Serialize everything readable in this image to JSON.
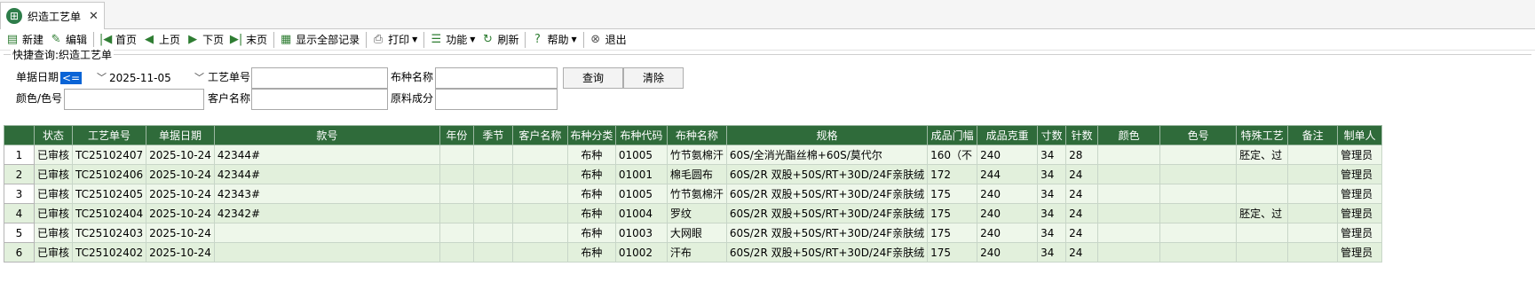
{
  "tab": {
    "title": "织造工艺单",
    "close": "✕",
    "icon": "grid-icon"
  },
  "toolbar": {
    "new": "新建",
    "edit": "编辑",
    "first": "首页",
    "prev": "上页",
    "next": "下页",
    "last": "末页",
    "show_all": "显示全部记录",
    "print": "打印",
    "function": "功能",
    "refresh": "刷新",
    "help": "帮助",
    "exit": "退出"
  },
  "query": {
    "legend": "快捷查询:织造工艺单",
    "date_label": "单据日期",
    "date_op": "<=",
    "date_value": "2025-11-05",
    "craft_no_label": "工艺单号",
    "fabric_name_label": "布种名称",
    "color_label": "颜色/色号",
    "customer_label": "客户名称",
    "material_label": "原料成分",
    "search_btn": "查询",
    "clear_btn": "清除"
  },
  "grid": {
    "headers": [
      "状态",
      "工艺单号",
      "单据日期",
      "款号",
      "年份",
      "季节",
      "客户名称",
      "布种分类",
      "布种代码",
      "布种名称",
      "规格",
      "成品门幅",
      "成品克重",
      "寸数",
      "针数",
      "颜色",
      "色号",
      "特殊工艺",
      "备注",
      "制单人"
    ],
    "rows": [
      {
        "n": "1",
        "status": "已审核",
        "no": "TC25102407",
        "date": "2025-10-24",
        "style": "42344#",
        "year": "",
        "season": "",
        "customer": "",
        "cat": "布种",
        "code": "01005",
        "name": "竹节氨棉汗",
        "spec": "60S/全消光酯丝棉+60S/莫代尔",
        "width": "160（不",
        "weight": "240",
        "inch": "34",
        "needle": "28",
        "color": "",
        "color_no": "",
        "special": "胚定、过",
        "remark": "",
        "maker": "管理员"
      },
      {
        "n": "2",
        "status": "已审核",
        "no": "TC25102406",
        "date": "2025-10-24",
        "style": "42344#",
        "year": "",
        "season": "",
        "customer": "",
        "cat": "布种",
        "code": "01001",
        "name": "棉毛圆布",
        "spec": "60S/2R 双股+50S/RT+30D/24F亲肤绒",
        "width": "172",
        "weight": "244",
        "inch": "34",
        "needle": "24",
        "color": "",
        "color_no": "",
        "special": "",
        "remark": "",
        "maker": "管理员"
      },
      {
        "n": "3",
        "status": "已审核",
        "no": "TC25102405",
        "date": "2025-10-24",
        "style": "42343#",
        "year": "",
        "season": "",
        "customer": "",
        "cat": "布种",
        "code": "01005",
        "name": "竹节氨棉汗",
        "spec": "60S/2R 双股+50S/RT+30D/24F亲肤绒",
        "width": "175",
        "weight": "240",
        "inch": "34",
        "needle": "24",
        "color": "",
        "color_no": "",
        "special": "",
        "remark": "",
        "maker": "管理员"
      },
      {
        "n": "4",
        "status": "已审核",
        "no": "TC25102404",
        "date": "2025-10-24",
        "style": "42342#",
        "year": "",
        "season": "",
        "customer": "",
        "cat": "布种",
        "code": "01004",
        "name": "罗纹",
        "spec": "60S/2R 双股+50S/RT+30D/24F亲肤绒",
        "width": "175",
        "weight": "240",
        "inch": "34",
        "needle": "24",
        "color": "",
        "color_no": "",
        "special": "胚定、过",
        "remark": "",
        "maker": "管理员"
      },
      {
        "n": "5",
        "status": "已审核",
        "no": "TC25102403",
        "date": "2025-10-24",
        "style": "",
        "year": "",
        "season": "",
        "customer": "",
        "cat": "布种",
        "code": "01003",
        "name": "大网眼",
        "spec": "60S/2R 双股+50S/RT+30D/24F亲肤绒",
        "width": "175",
        "weight": "240",
        "inch": "34",
        "needle": "24",
        "color": "",
        "color_no": "",
        "special": "",
        "remark": "",
        "maker": "管理员"
      },
      {
        "n": "6",
        "status": "已审核",
        "no": "TC25102402",
        "date": "2025-10-24",
        "style": "",
        "year": "",
        "season": "",
        "customer": "",
        "cat": "布种",
        "code": "01002",
        "name": "汗布",
        "spec": "60S/2R 双股+50S/RT+30D/24F亲肤绒",
        "width": "175",
        "weight": "240",
        "inch": "34",
        "needle": "24",
        "color": "",
        "color_no": "",
        "special": "",
        "remark": "",
        "maker": "管理员"
      }
    ]
  },
  "colors": {
    "header_bg": "#2f6b3a",
    "row_bg": "#eef7ea",
    "accent": "#0a64d6"
  }
}
